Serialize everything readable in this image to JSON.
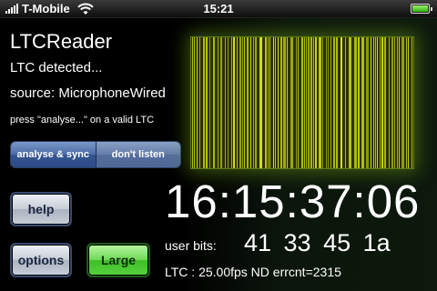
{
  "status_bar": {
    "carrier": "T-Mobile",
    "time": "15:21",
    "signal_icon": "signal-bars-icon",
    "wifi_icon": "wifi-icon",
    "battery_icon": "battery-icon",
    "battery_level": 1.0,
    "battery_color": "#2fb40c"
  },
  "app": {
    "title": "LTCReader",
    "status": "LTC detected...",
    "source": "source: MicrophoneWired",
    "hint": "press \"analyse...\" on a valid LTC"
  },
  "segmented": {
    "active_label": "analyse & sync",
    "inactive_label": "don't listen"
  },
  "buttons": {
    "help": "help",
    "options": "options",
    "large": "Large",
    "large_color": "#3fbe28"
  },
  "display": {
    "timecode": "16:15:37:06",
    "user_bits_label": "user bits:",
    "user_bits_value": "41 33 45 1a",
    "ltc_info": "LTC : 25.00fps ND errcnt=2315"
  },
  "waveform": {
    "bar_color": "#d8e610",
    "bg_color": "#2a3200",
    "glow_color": "#78aa14"
  }
}
